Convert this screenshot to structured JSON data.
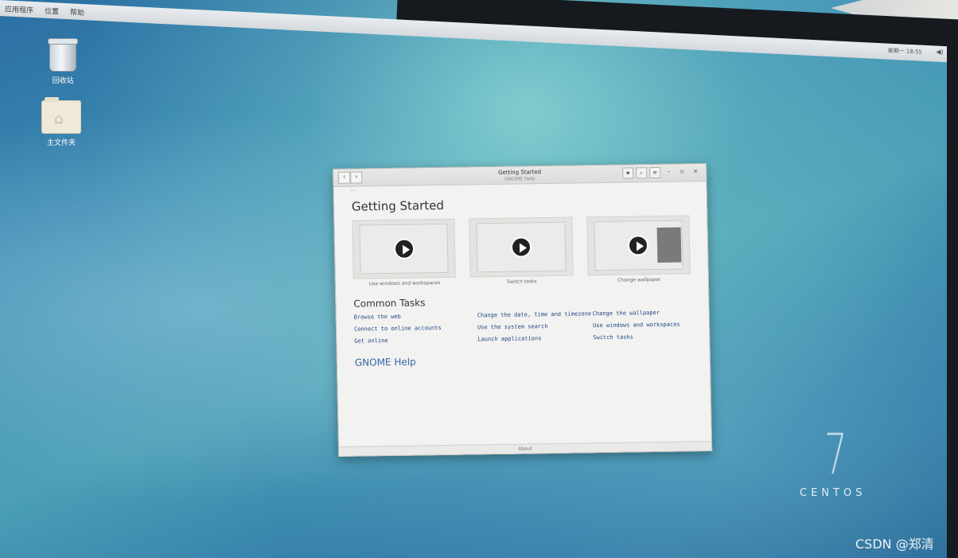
{
  "top_panel": {
    "menus": [
      "应用程序",
      "位置",
      "帮助"
    ],
    "clock": "星期一 18:55",
    "tray_icons": [
      "volume-icon",
      "power-icon"
    ]
  },
  "desktop": {
    "icons": [
      {
        "label": "回收站",
        "icon": "trash-icon"
      },
      {
        "label": "主文件夹",
        "icon": "home-folder-icon"
      }
    ],
    "branding_number": "7",
    "branding_word": "CENTOS",
    "watermark": "CSDN @郑清"
  },
  "window": {
    "title": "Getting Started",
    "subtitle": "GNOME Help",
    "nav": {
      "back": "‹",
      "forward": "›"
    },
    "toolbar": {
      "bookmark": "★",
      "search": "⌕",
      "menu": "≡"
    },
    "controls": {
      "minimize": "–",
      "maximize": "▫",
      "close": "×"
    },
    "heading": "Getting Started",
    "videos": [
      {
        "caption": "Use windows and workspaces"
      },
      {
        "caption": "Switch tasks"
      },
      {
        "caption": "Change wallpaper"
      }
    ],
    "common_tasks_heading": "Common Tasks",
    "tasks": [
      [
        "Browse the web",
        "Change the date, time and timezone",
        "Change the wallpaper"
      ],
      [
        "Connect to online accounts",
        "Use the system search",
        "Use windows and workspaces"
      ],
      [
        "Get online",
        "Launch applications",
        "Switch tasks"
      ]
    ],
    "help_link": "GNOME Help",
    "footer": "About"
  }
}
